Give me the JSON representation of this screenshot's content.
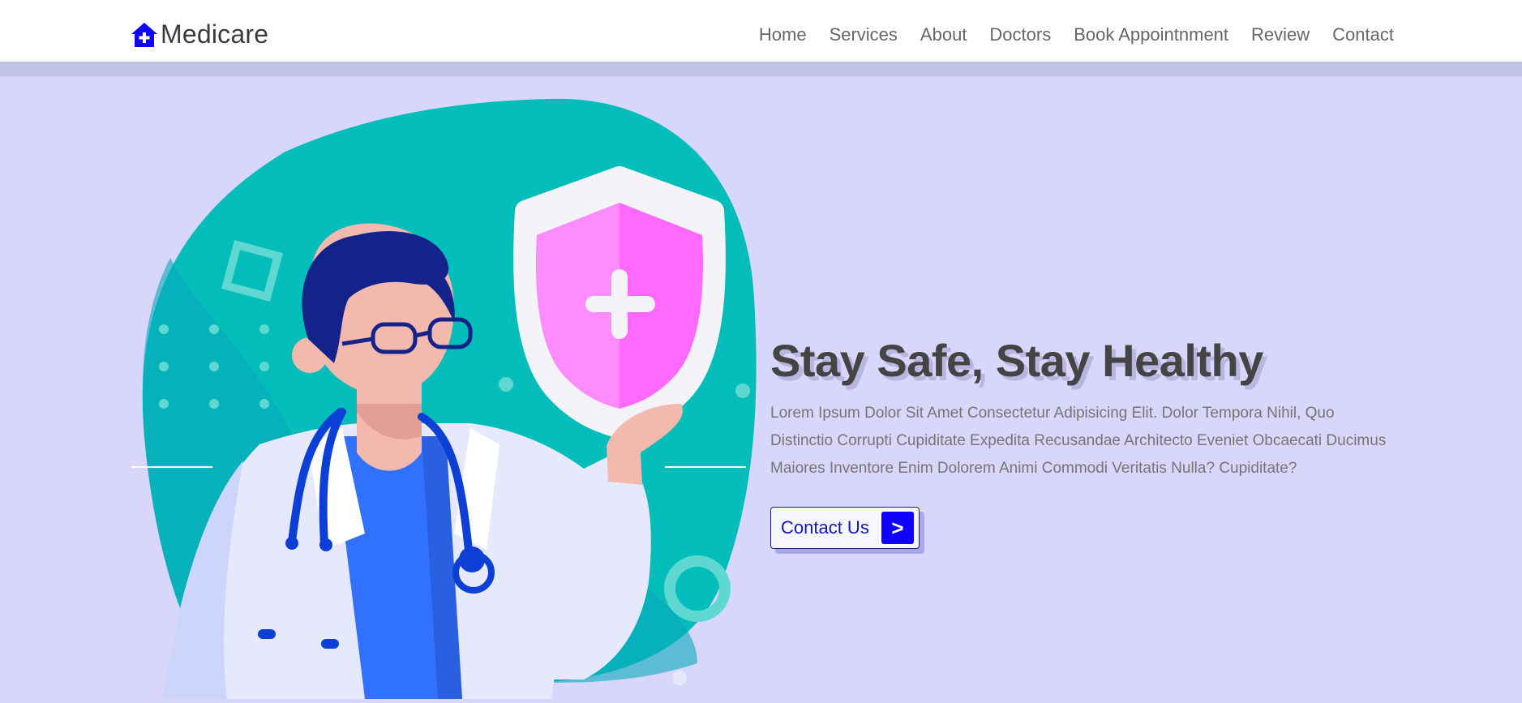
{
  "colors": {
    "brand": "#0f00ff",
    "page_background": "#d8d6fb",
    "header_background": "#ffffff",
    "teal": "#02bdb9",
    "title": "#444444"
  },
  "header": {
    "logo": {
      "icon": "house-medical-icon",
      "text": "Medicare"
    },
    "nav": [
      {
        "label": "Home"
      },
      {
        "label": "Services"
      },
      {
        "label": "About"
      },
      {
        "label": "Doctors"
      },
      {
        "label": "Book Appointnment"
      },
      {
        "label": "Review"
      },
      {
        "label": "Contact"
      }
    ]
  },
  "hero": {
    "illustration": "doctor-with-shield-illustration",
    "title": "Stay Safe, Stay Healthy",
    "description": "Lorem Ipsum Dolor Sit Amet Consectetur Adipisicing Elit. Dolor Tempora Nihil, Quo Distinctio Corrupti Cupiditate Expedita Recusandae Architecto Eveniet Obcaecati Ducimus Maiores Inventore Enim Dolorem Animi Commodi Veritatis Nulla? Cupiditate?",
    "cta": {
      "label": "Contact Us",
      "arrow": ">"
    }
  }
}
